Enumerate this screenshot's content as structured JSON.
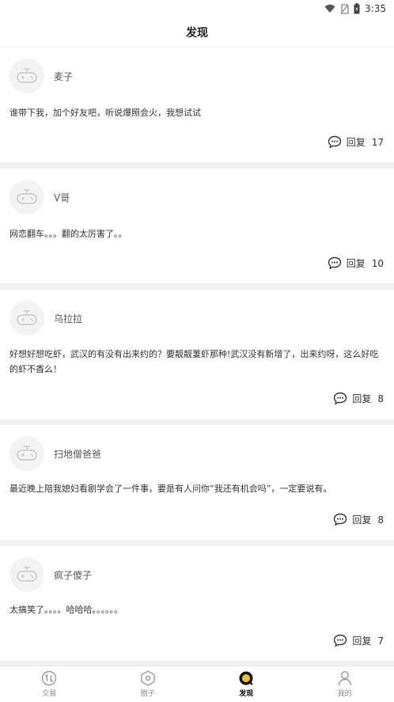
{
  "status_bar": {
    "time": "3:35"
  },
  "header": {
    "title": "发现"
  },
  "posts": [
    {
      "username": "麦子",
      "content": "谁带下我，加个好友吧，听说爆照会火，我想试试",
      "reply_label": "回复",
      "reply_count": "17"
    },
    {
      "username": "V哥",
      "content": "网恋翻车。。。翻的太厉害了。。",
      "reply_label": "回复",
      "reply_count": "10"
    },
    {
      "username": "乌拉拉",
      "content": "好想好想吃虾，武汉的有没有出来约的？要靓靓萋虾那种!武汉没有新增了，出来约呀，这么好吃的虾不香么！",
      "reply_label": "回复",
      "reply_count": "8"
    },
    {
      "username": "扫地僧爸爸",
      "content": "最近晚上陪我媳妇看剧学会了一件事，要是有人问你”我还有机会吗”，一定要说有。",
      "reply_label": "回复",
      "reply_count": "8"
    },
    {
      "username": "疯子傻子",
      "content": "太搞笑了。。。。哈哈哈。。。。。。",
      "reply_label": "回复",
      "reply_count": "7"
    }
  ],
  "tab_bar": {
    "tabs": [
      {
        "label": "交易",
        "icon": "trade-icon",
        "active": false
      },
      {
        "label": "圈子",
        "icon": "circle-icon",
        "active": false
      },
      {
        "label": "发现",
        "icon": "discover-icon",
        "active": true
      },
      {
        "label": "我的",
        "icon": "profile-icon",
        "active": false
      }
    ]
  },
  "colors": {
    "accent": "#f5c518",
    "divider": "#f2f2f2"
  }
}
